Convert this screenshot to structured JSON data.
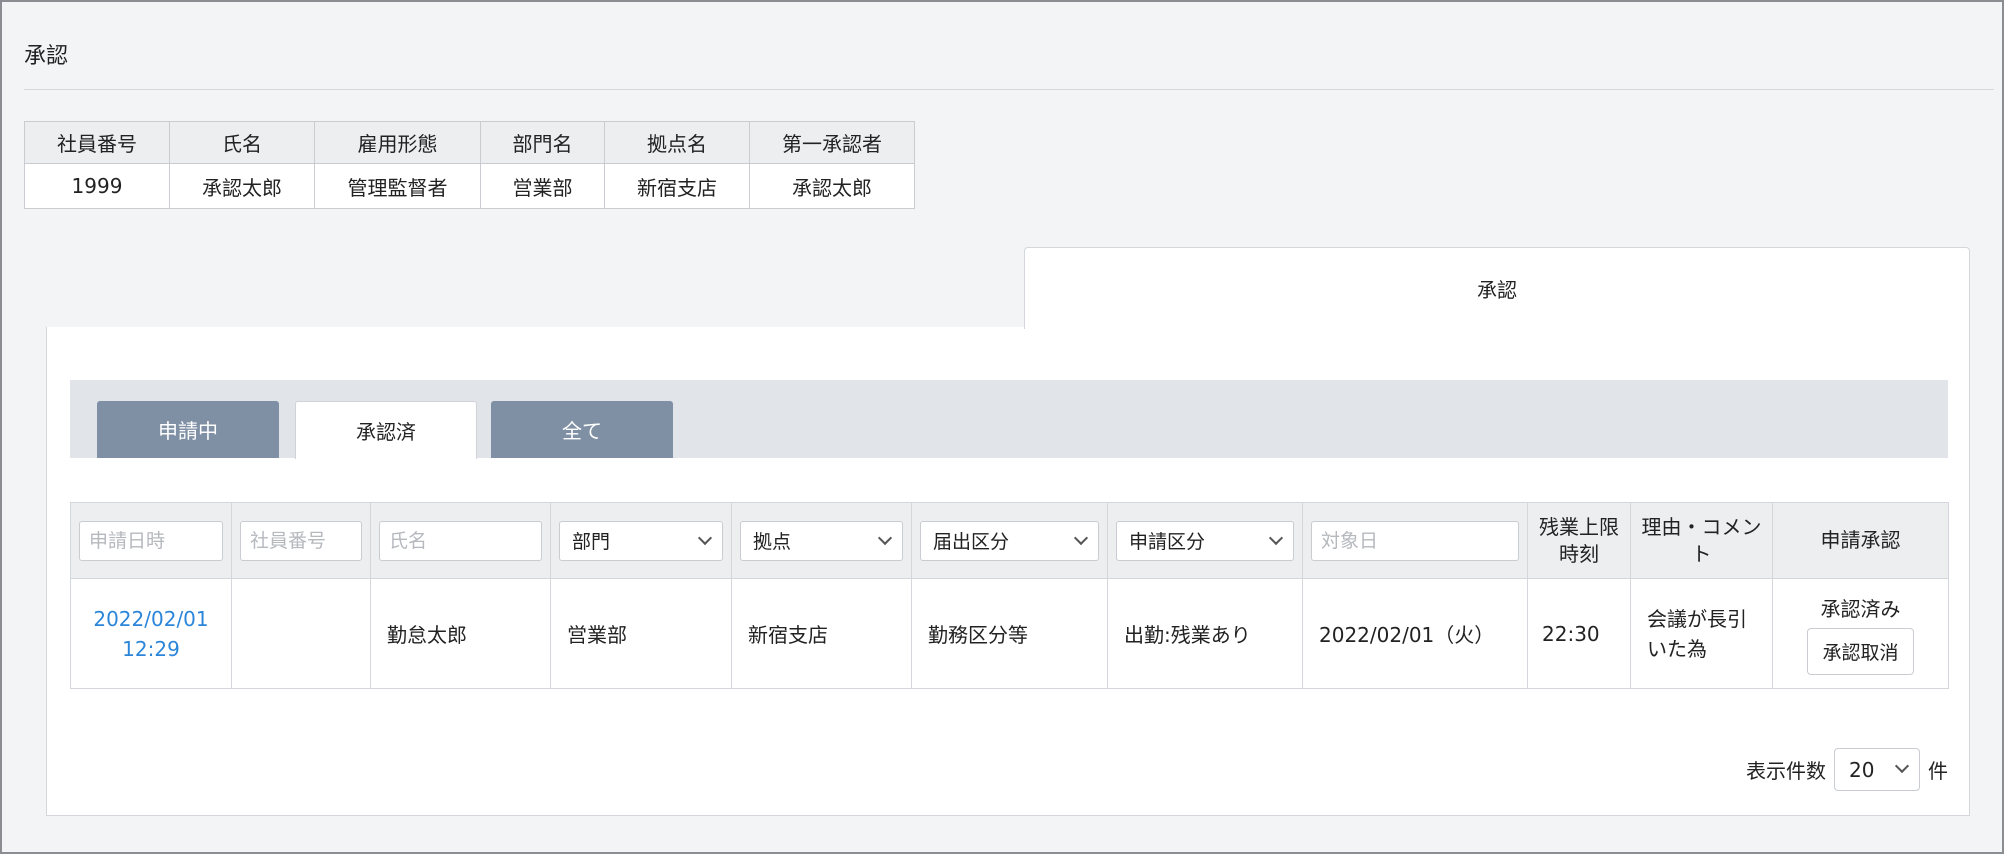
{
  "page": {
    "title": "承認"
  },
  "employee": {
    "headers": [
      "社員番号",
      "氏名",
      "雇用形態",
      "部門名",
      "拠点名",
      "第一承認者"
    ],
    "values": [
      "1999",
      "承認太郎",
      "管理監督者",
      "営業部",
      "新宿支店",
      "承認太郎"
    ]
  },
  "outer_tab": {
    "label": "承認"
  },
  "subtabs": [
    {
      "label": "申請中",
      "state": "inactive"
    },
    {
      "label": "承認済",
      "state": "active"
    },
    {
      "label": "全て",
      "state": "inactive"
    }
  ],
  "filters": {
    "date_placeholder": "申請日時",
    "emp_no_placeholder": "社員番号",
    "name_placeholder": "氏名",
    "dept_label": "部門",
    "site_label": "拠点",
    "notice_label": "届出区分",
    "app_type_label": "申請区分",
    "target_date_placeholder": "対象日"
  },
  "columns": {
    "overtime_limit": "残業上限時刻",
    "reason": "理由・コメント",
    "approval": "申請承認"
  },
  "rows": [
    {
      "date_line1": "2022/02/01",
      "date_line2": "12:29",
      "emp_no": "",
      "name": "勤怠太郎",
      "dept": "営業部",
      "site": "新宿支店",
      "notice_type": "勤務区分等",
      "app_type": "出勤:残業あり",
      "target_date": "2022/02/01（火）",
      "overtime_limit": "22:30",
      "reason": "会議が長引いた為",
      "status": "承認済み",
      "cancel_label": "承認取消"
    }
  ],
  "pagination": {
    "label": "表示件数",
    "value": "20",
    "unit": "件"
  },
  "colors": {
    "link": "#2b86d9",
    "subtab_inactive": "#7f90a5",
    "background": "#f3f4f6"
  }
}
